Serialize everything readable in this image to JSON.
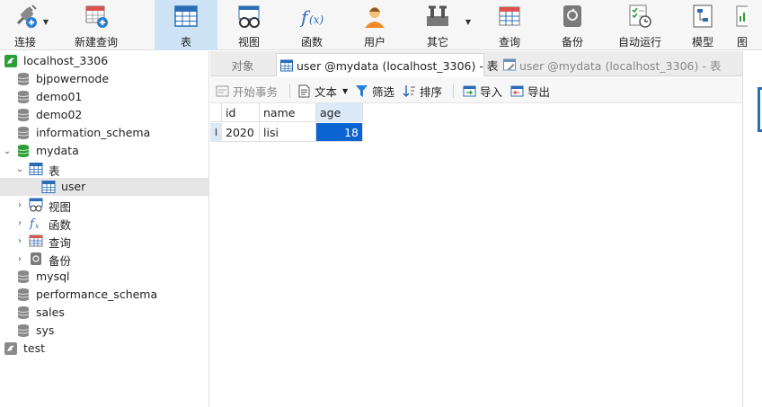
{
  "toolbar": {
    "items": [
      {
        "label": "连接",
        "icon": "plug-icon",
        "caret": true
      },
      {
        "label": "新建查询",
        "icon": "new-query-icon"
      },
      {
        "label": "表",
        "icon": "table-icon",
        "active": true
      },
      {
        "label": "视图",
        "icon": "view-icon"
      },
      {
        "label": "函数",
        "icon": "function-icon"
      },
      {
        "label": "用户",
        "icon": "user-icon"
      },
      {
        "label": "其它",
        "icon": "tools-icon",
        "caret": true
      },
      {
        "label": "查询",
        "icon": "query-icon"
      },
      {
        "label": "备份",
        "icon": "backup-icon"
      },
      {
        "label": "自动运行",
        "icon": "schedule-icon"
      },
      {
        "label": "模型",
        "icon": "model-icon"
      },
      {
        "label": "图",
        "icon": "chart-icon"
      }
    ]
  },
  "sidebar": {
    "connection": "localhost_3306",
    "databases": [
      "bjpowernode",
      "demo01",
      "demo02",
      "information_schema"
    ],
    "open_db": "mydata",
    "tables_node": "表",
    "table_user": "user",
    "views_node": "视图",
    "functions_node": "函数",
    "queries_node": "查询",
    "backups_node": "备份",
    "databases_after": [
      "mysql",
      "performance_schema",
      "sales",
      "sys"
    ],
    "other_connection": "test"
  },
  "tabs": {
    "objects": "对象",
    "active": "user @mydata (localhost_3306) - 表",
    "inactive": "user @mydata (localhost_3306) - 表"
  },
  "grid_toolbar": {
    "begin_transaction": "开始事务",
    "text": "文本",
    "filter": "筛选",
    "sort": "排序",
    "import": "导入",
    "export": "导出"
  },
  "grid": {
    "columns": [
      "id",
      "name",
      "age"
    ],
    "rows": [
      {
        "id": "2020",
        "name": "lisi",
        "age": "18"
      }
    ],
    "row_indicator": "I"
  },
  "colors": {
    "accent": "#0a64d2",
    "active_toolbar": "#cfe3f7",
    "db_green": "#2e9e3a"
  }
}
